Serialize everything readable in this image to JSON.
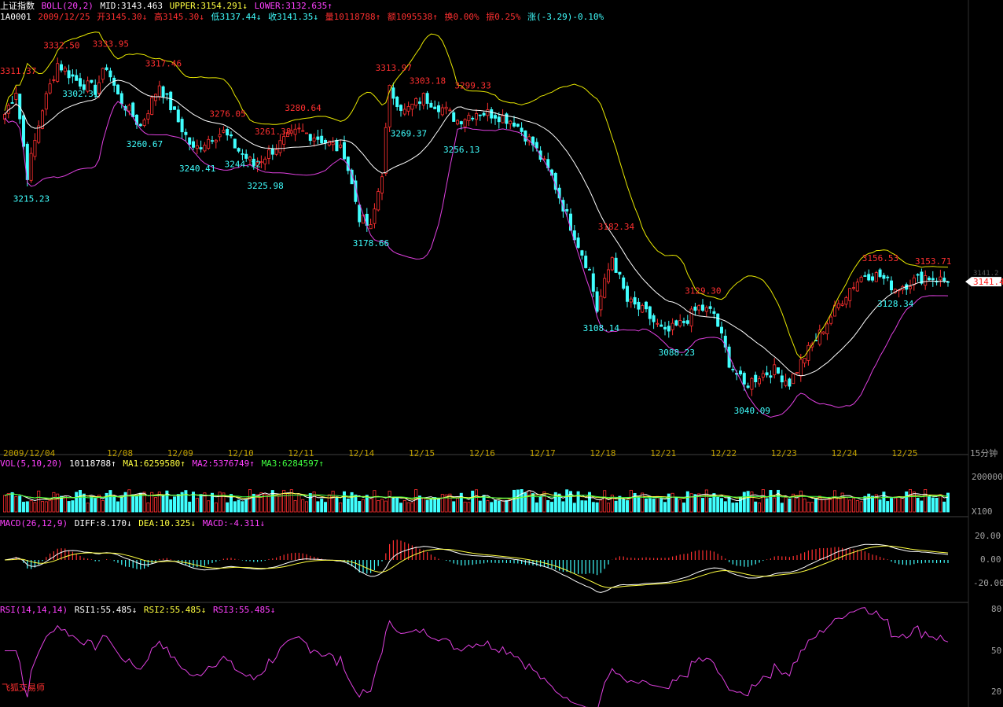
{
  "header": {
    "index_name": "上证指数",
    "boll_label": "BOLL(20,2)",
    "mid": "MID:3143.463",
    "upper": "UPPER:3154.291↓",
    "lower": "LOWER:3132.635↑",
    "code": "1A0001",
    "date": "2009/12/25",
    "open": "开3145.30↓",
    "high": "高3145.30↓",
    "low": "低3137.44↓",
    "close": "收3141.35↓",
    "volume": "量10118788↑",
    "amount": "额1095538↑",
    "turnover": "换0.00%",
    "amplitude": "振0.25%",
    "change": "涨(-3.29)-0.10%"
  },
  "price_label": "3141.4",
  "price_tag_faint": "3141.2",
  "time_axis": {
    "labels": [
      "2009/12/04",
      "12/08",
      "12/09",
      "12/10",
      "12/11",
      "12/14",
      "12/15",
      "12/16",
      "12/17",
      "12/18",
      "12/21",
      "12/22",
      "12/23",
      "12/24",
      "12/25"
    ],
    "period": "15分钟"
  },
  "vol_panel": {
    "title": "VOL(5,10,20)",
    "value": "10118788↑",
    "ma1": "MA1:6259580↑",
    "ma2": "MA2:5376749↑",
    "ma3": "MA3:6284597↑",
    "scale_top": "200000",
    "scale_unit": "X100"
  },
  "macd_panel": {
    "title": "MACD(26,12,9)",
    "diff": "DIFF:8.170↓",
    "dea": "DEA:10.325↓",
    "macd": "MACD:-4.311↓",
    "scale": [
      "20.00",
      "0.00",
      "-20.00"
    ]
  },
  "rsi_panel": {
    "title": "RSI(14,14,14)",
    "rsi1": "RSI1:55.485↓",
    "rsi2": "RSI2:55.485↓",
    "rsi3": "RSI3:55.485↓",
    "scale": [
      "80",
      "50",
      "20"
    ]
  },
  "watermark": "飞狐交易师",
  "colors": {
    "up": "#ff3030",
    "down": "#40ffff",
    "mid": "#ffffff",
    "upper": "#e8e800",
    "lower": "#e040e0",
    "ma2": "#ffff40",
    "ma3": "#40ff40"
  },
  "chart_data": {
    "type": "candlestick",
    "indicator": "BOLL(20,2)",
    "period": "15分钟",
    "ylim": [
      3010,
      3355
    ],
    "annotations": [
      {
        "label": "3311.37",
        "value": 3311.37,
        "kind": "high",
        "bar": 1
      },
      {
        "label": "3215.23",
        "value": 3215.23,
        "kind": "low",
        "bar": 6
      },
      {
        "label": "3332.50",
        "value": 3332.5,
        "kind": "high",
        "bar": 14
      },
      {
        "label": "3302.31",
        "value": 3302.31,
        "kind": "low",
        "bar": 19
      },
      {
        "label": "3333.95",
        "value": 3333.95,
        "kind": "high",
        "bar": 27
      },
      {
        "label": "3260.67",
        "value": 3260.67,
        "kind": "low",
        "bar": 36
      },
      {
        "label": "3317.46",
        "value": 3317.46,
        "kind": "high",
        "bar": 41
      },
      {
        "label": "3240.41",
        "value": 3240.41,
        "kind": "low",
        "bar": 50
      },
      {
        "label": "3276.05",
        "value": 3276.05,
        "kind": "high",
        "bar": 58
      },
      {
        "label": "3244.12",
        "value": 3244.12,
        "kind": "low",
        "bar": 62
      },
      {
        "label": "3261.38",
        "value": 3261.38,
        "kind": "high",
        "bar": 70
      },
      {
        "label": "3225.98",
        "value": 3225.98,
        "kind": "low",
        "bar": 68
      },
      {
        "label": "3280.64",
        "value": 3280.64,
        "kind": "high",
        "bar": 78
      },
      {
        "label": "3178.66",
        "value": 3178.66,
        "kind": "low",
        "bar": 96
      },
      {
        "label": "3313.97",
        "value": 3313.97,
        "kind": "high",
        "bar": 102
      },
      {
        "label": "3269.37",
        "value": 3269.37,
        "kind": "low",
        "bar": 106
      },
      {
        "label": "3303.18",
        "value": 3303.18,
        "kind": "high",
        "bar": 111
      },
      {
        "label": "3299.33",
        "value": 3299.33,
        "kind": "high",
        "bar": 123
      },
      {
        "label": "3256.13",
        "value": 3256.13,
        "kind": "low",
        "bar": 120
      },
      {
        "label": "3182.34",
        "value": 3182.34,
        "kind": "high",
        "bar": 161
      },
      {
        "label": "3108.14",
        "value": 3108.14,
        "kind": "low",
        "bar": 157
      },
      {
        "label": "3129.30",
        "value": 3129.3,
        "kind": "high",
        "bar": 184
      },
      {
        "label": "3088.23",
        "value": 3088.23,
        "kind": "low",
        "bar": 177
      },
      {
        "label": "3040.09",
        "value": 3040.09,
        "kind": "low",
        "bar": 197
      },
      {
        "label": "3156.53",
        "value": 3156.53,
        "kind": "high",
        "bar": 231
      },
      {
        "label": "3128.34",
        "value": 3128.34,
        "kind": "low",
        "bar": 235
      },
      {
        "label": "3153.71",
        "value": 3153.71,
        "kind": "high",
        "bar": 245
      }
    ],
    "close_anchors": [
      [
        0,
        3280
      ],
      [
        3,
        3300
      ],
      [
        6,
        3230
      ],
      [
        10,
        3285
      ],
      [
        14,
        3322
      ],
      [
        19,
        3308
      ],
      [
        24,
        3300
      ],
      [
        27,
        3320
      ],
      [
        30,
        3295
      ],
      [
        36,
        3270
      ],
      [
        41,
        3305
      ],
      [
        45,
        3280
      ],
      [
        50,
        3250
      ],
      [
        55,
        3262
      ],
      [
        58,
        3265
      ],
      [
        62,
        3250
      ],
      [
        66,
        3238
      ],
      [
        70,
        3248
      ],
      [
        74,
        3258
      ],
      [
        78,
        3266
      ],
      [
        82,
        3262
      ],
      [
        86,
        3256
      ],
      [
        90,
        3248
      ],
      [
        94,
        3195
      ],
      [
        97,
        3185
      ],
      [
        100,
        3232
      ],
      [
        102,
        3300
      ],
      [
        106,
        3282
      ],
      [
        111,
        3294
      ],
      [
        116,
        3285
      ],
      [
        120,
        3275
      ],
      [
        125,
        3282
      ],
      [
        130,
        3280
      ],
      [
        135,
        3274
      ],
      [
        140,
        3255
      ],
      [
        145,
        3228
      ],
      [
        150,
        3188
      ],
      [
        155,
        3150
      ],
      [
        157,
        3118
      ],
      [
        161,
        3162
      ],
      [
        165,
        3125
      ],
      [
        170,
        3115
      ],
      [
        175,
        3098
      ],
      [
        180,
        3108
      ],
      [
        184,
        3120
      ],
      [
        188,
        3115
      ],
      [
        192,
        3075
      ],
      [
        196,
        3055
      ],
      [
        200,
        3064
      ],
      [
        204,
        3068
      ],
      [
        208,
        3058
      ],
      [
        212,
        3080
      ],
      [
        216,
        3098
      ],
      [
        220,
        3118
      ],
      [
        224,
        3136
      ],
      [
        228,
        3148
      ],
      [
        232,
        3146
      ],
      [
        236,
        3136
      ],
      [
        240,
        3141
      ],
      [
        244,
        3146
      ],
      [
        248,
        3143
      ],
      [
        250,
        3141.35
      ]
    ]
  }
}
